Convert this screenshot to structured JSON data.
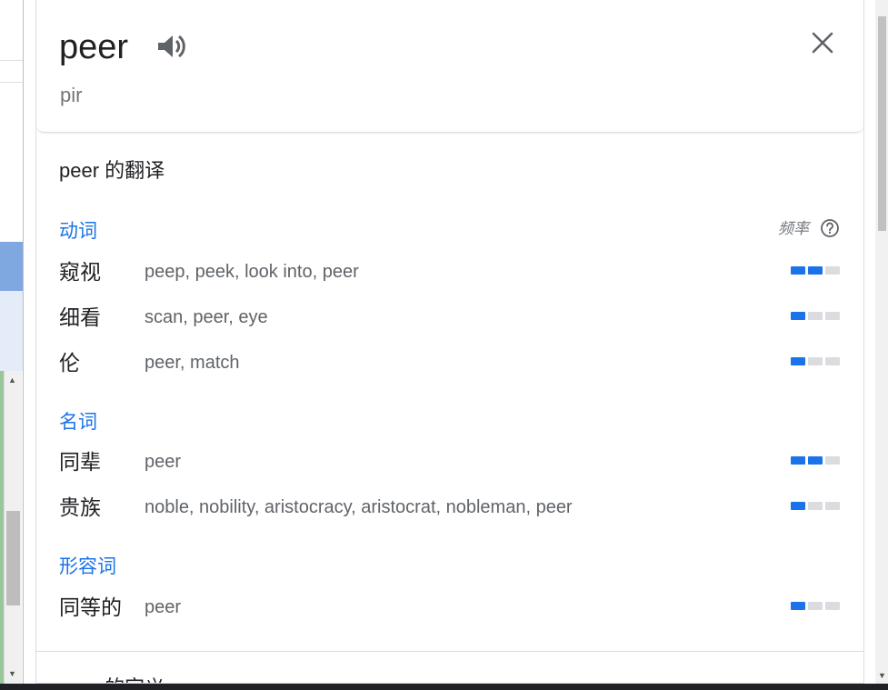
{
  "header": {
    "word": "peer",
    "phonetic": "pir",
    "speaker_icon": "speaker-icon",
    "close_icon": "close-icon"
  },
  "translations": {
    "title": "peer 的翻译",
    "frequency_label": "频率",
    "help_icon": "help-circle-icon",
    "groups": [
      {
        "pos": "动词",
        "rows": [
          {
            "zh": "窥视",
            "en": "peep, peek, look into, peer",
            "freq": 2
          },
          {
            "zh": "细看",
            "en": "scan, peer, eye",
            "freq": 1
          },
          {
            "zh": "伦",
            "en": "peer, match",
            "freq": 1
          }
        ]
      },
      {
        "pos": "名词",
        "rows": [
          {
            "zh": "同辈",
            "en": "peer",
            "freq": 2
          },
          {
            "zh": "贵族",
            "en": "noble, nobility, aristocracy, aristocrat, nobleman, peer",
            "freq": 1
          }
        ]
      },
      {
        "pos": "形容词",
        "rows": [
          {
            "zh": "同等的",
            "en": "peer",
            "freq": 1
          }
        ]
      }
    ]
  },
  "definitions_peek": "peer 的定义",
  "colors": {
    "accent": "#1a73e8",
    "bar_active": "#1a73e8",
    "bar_inactive": "#dadce0",
    "text_primary": "#202124",
    "text_secondary": "#5f6368"
  }
}
